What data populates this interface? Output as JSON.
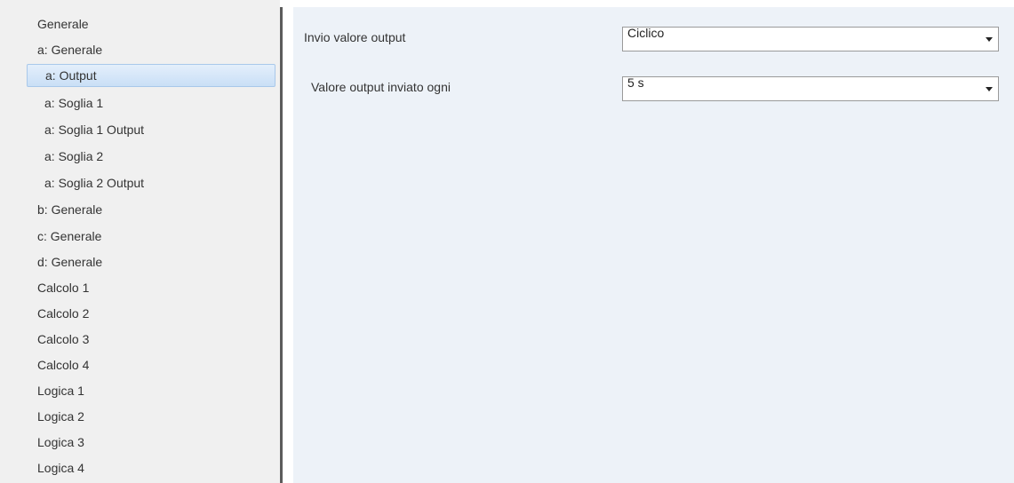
{
  "sidebar": {
    "items": [
      {
        "label": "Generale"
      },
      {
        "label": "a: Generale"
      },
      {
        "label": "a: Output",
        "selected": true
      },
      {
        "label": "a: Soglia 1"
      },
      {
        "label": "a: Soglia 1 Output"
      },
      {
        "label": "a: Soglia 2"
      },
      {
        "label": "a: Soglia 2 Output"
      },
      {
        "label": "b: Generale"
      },
      {
        "label": "c: Generale"
      },
      {
        "label": "d: Generale"
      },
      {
        "label": "Calcolo 1"
      },
      {
        "label": "Calcolo 2"
      },
      {
        "label": "Calcolo 3"
      },
      {
        "label": "Calcolo 4"
      },
      {
        "label": "Logica 1"
      },
      {
        "label": "Logica 2"
      },
      {
        "label": "Logica 3"
      },
      {
        "label": "Logica 4"
      }
    ]
  },
  "params": {
    "send_output": {
      "label": "Invio valore output",
      "value": "Ciclico"
    },
    "send_interval": {
      "label": "Valore output inviato ogni",
      "value": "5 s"
    }
  },
  "colors": {
    "content_bg": "#edf2f8",
    "sidebar_bg": "#f0f0f0",
    "selection": "#c9dff6"
  }
}
